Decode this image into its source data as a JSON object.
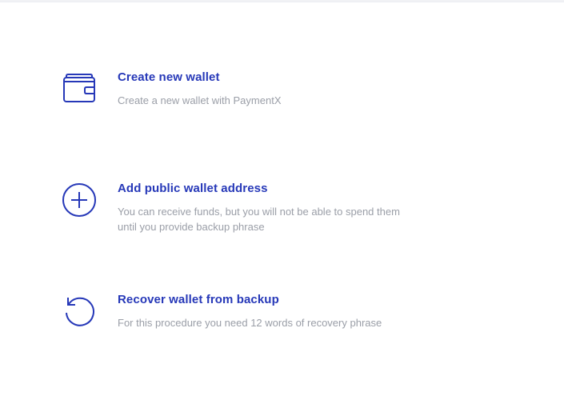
{
  "options": [
    {
      "icon": "wallet-icon",
      "title": "Create new wallet",
      "description": "Create a new wallet with PaymentX"
    },
    {
      "icon": "plus-circle-icon",
      "title": "Add public wallet address",
      "description_line1": "You can receive funds, but you will not be able to spend them",
      "description_line2": "until you provide backup phrase"
    },
    {
      "icon": "restore-icon",
      "title": "Recover wallet from backup",
      "description": "For this procedure you need 12 words of recovery phrase"
    }
  ],
  "colors": {
    "accent": "#2638b8",
    "muted_text": "#9a9ea7",
    "background": "#ffffff"
  }
}
